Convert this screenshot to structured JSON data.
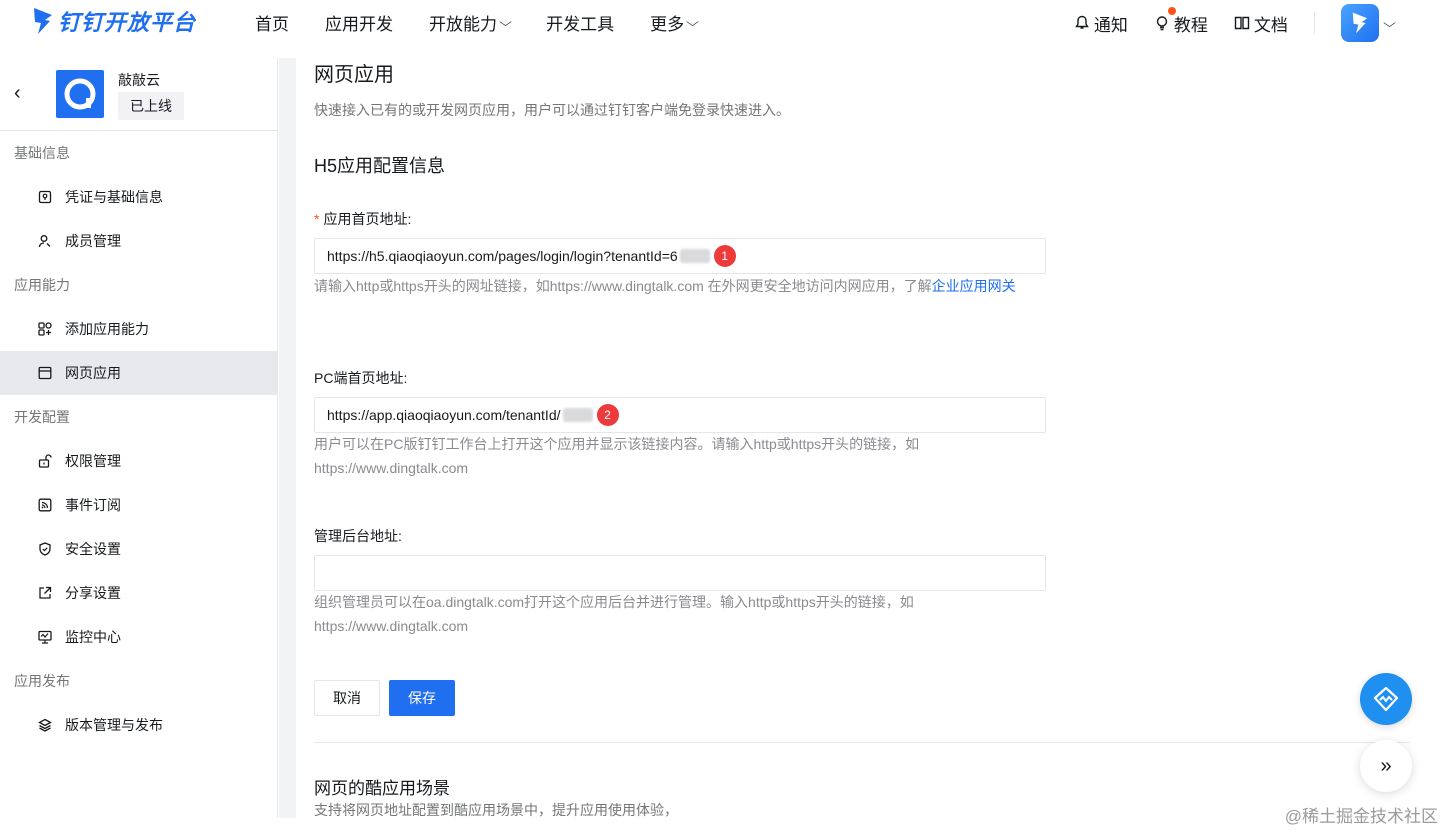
{
  "brand": {
    "name": "钉钉开放平台",
    "color": "#1f6ff0"
  },
  "nav": {
    "items": [
      {
        "label": "首页",
        "has_dropdown": false
      },
      {
        "label": "应用开发",
        "has_dropdown": false
      },
      {
        "label": "开放能力",
        "has_dropdown": true
      },
      {
        "label": "开发工具",
        "has_dropdown": false
      },
      {
        "label": "更多",
        "has_dropdown": true
      }
    ],
    "chevron": "⌵"
  },
  "topright": {
    "notify": "通知",
    "tutorial": "教程",
    "docs": "文档",
    "chevron": "⌵"
  },
  "sidebar": {
    "back": "‹",
    "app_name": "敲敲云",
    "app_status": "已上线",
    "groups": [
      {
        "title": "基础信息",
        "items": [
          {
            "label": "凭证与基础信息",
            "icon": "credential-icon",
            "active": false
          },
          {
            "label": "成员管理",
            "icon": "member-icon",
            "active": false
          }
        ]
      },
      {
        "title": "应用能力",
        "items": [
          {
            "label": "添加应用能力",
            "icon": "grid-plus-icon",
            "active": false
          },
          {
            "label": "网页应用",
            "icon": "browser-icon",
            "active": true
          }
        ]
      },
      {
        "title": "开发配置",
        "items": [
          {
            "label": "权限管理",
            "icon": "lock-icon",
            "active": false
          },
          {
            "label": "事件订阅",
            "icon": "rss-icon",
            "active": false
          },
          {
            "label": "安全设置",
            "icon": "shield-icon",
            "active": false
          },
          {
            "label": "分享设置",
            "icon": "share-icon",
            "active": false
          },
          {
            "label": "监控中心",
            "icon": "monitor-icon",
            "active": false
          }
        ]
      },
      {
        "title": "应用发布",
        "items": [
          {
            "label": "版本管理与发布",
            "icon": "layers-icon",
            "active": false
          }
        ]
      }
    ]
  },
  "main": {
    "title": "网页应用",
    "description": "快速接入已有的或开发网页应用，用户可以通过钉钉客户端免登录快速进入。",
    "section_title": "H5应用配置信息",
    "fields": {
      "h5": {
        "required_mark": "*",
        "label": "应用首页地址:",
        "value": "https://h5.qiaoqiaoyun.com/pages/login/login?tenantId=6",
        "badge": "1",
        "help_prefix": "请输入http或https开头的网址链接，如https://www.dingtalk.com 在外网更安全地访问内网应用，了解",
        "help_link": "企业应用网关"
      },
      "pc": {
        "label": "PC端首页地址:",
        "value": "https://app.qiaoqiaoyun.com/tenantId/",
        "badge": "2",
        "help": "用户可以在PC版钉钉工作台上打开这个应用并显示该链接内容。请输入http或https开头的链接，如https://www.dingtalk.com"
      },
      "admin": {
        "label": "管理后台地址:",
        "value": "",
        "help": "组织管理员可以在oa.dingtalk.com打开这个应用后台并进行管理。输入http或https开头的链接，如https://www.dingtalk.com"
      }
    },
    "buttons": {
      "cancel": "取消",
      "save": "保存"
    },
    "cool_app": {
      "title": "网页的酷应用场景",
      "description": "支持将网页地址配置到酷应用场景中，提升应用使用体验，"
    }
  },
  "fab": {
    "expand": "»"
  },
  "watermark": "@稀土掘金技术社区"
}
